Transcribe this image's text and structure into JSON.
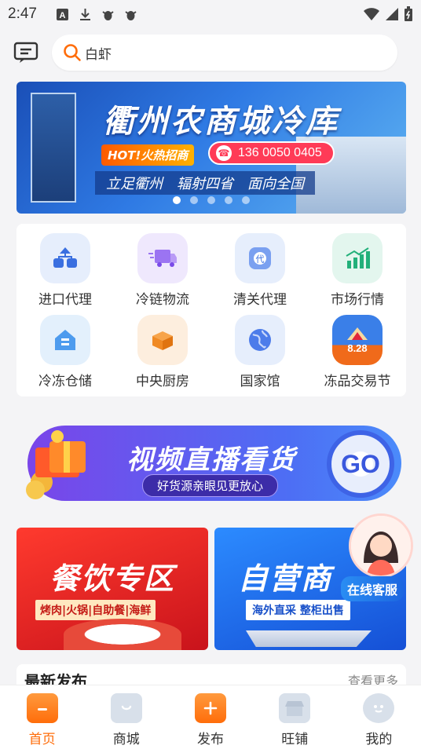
{
  "status_bar": {
    "time": "2:47",
    "notification_icons": [
      "a-icon",
      "download-icon",
      "bug-icon",
      "bug-icon"
    ],
    "right_icons": [
      "wifi-icon",
      "signal-icon",
      "battery-icon"
    ]
  },
  "search": {
    "value": "白虾"
  },
  "banner": {
    "title": "衢州农商城冷库",
    "hot_tag": "HOT!火热招商",
    "phone": "136 0050 0405",
    "slogans": [
      "立足衢州",
      "辐射四省",
      "面向全国"
    ],
    "slide_count": 5,
    "active_slide": 0
  },
  "grid": [
    {
      "label": "进口代理",
      "icon": "org-chart-icon",
      "color": "#3a6fe0"
    },
    {
      "label": "冷链物流",
      "icon": "truck-icon",
      "color": "#8a5cf0"
    },
    {
      "label": "清关代理",
      "icon": "stamp-icon",
      "color": "#3a6fe0"
    },
    {
      "label": "市场行情",
      "icon": "chart-up-icon",
      "color": "#22b07a"
    },
    {
      "label": "冷冻仓储",
      "icon": "warehouse-icon",
      "color": "#3a8fe8"
    },
    {
      "label": "中央厨房",
      "icon": "box-icon",
      "color": "#f08a24"
    },
    {
      "label": "国家馆",
      "icon": "globe-icon",
      "color": "#3a6fe0"
    },
    {
      "label": "冻品交易节",
      "icon": "festival-icon",
      "color": "#e85a1a",
      "badge": "8.28"
    }
  ],
  "live_banner": {
    "title": "视频直播看货",
    "subtitle": "好货源亲眼见更放心",
    "go": "GO"
  },
  "promos": {
    "food": {
      "title": "餐饮专区",
      "subtitle": "烤肉|火锅|自助餐|海鲜"
    },
    "self": {
      "title": "自营商",
      "subtitle": "海外直采  整柜出售"
    }
  },
  "customer_service": {
    "label": "在线客服"
  },
  "latest": {
    "title": "最新发布",
    "more": "查看更多"
  },
  "tabs": [
    {
      "label": "首页",
      "icon": "home-icon",
      "active": true
    },
    {
      "label": "商城",
      "icon": "shop-icon",
      "active": false
    },
    {
      "label": "发布",
      "icon": "publish-icon",
      "active": false
    },
    {
      "label": "旺铺",
      "icon": "store-icon",
      "active": false
    },
    {
      "label": "我的",
      "icon": "profile-icon",
      "active": false
    }
  ]
}
